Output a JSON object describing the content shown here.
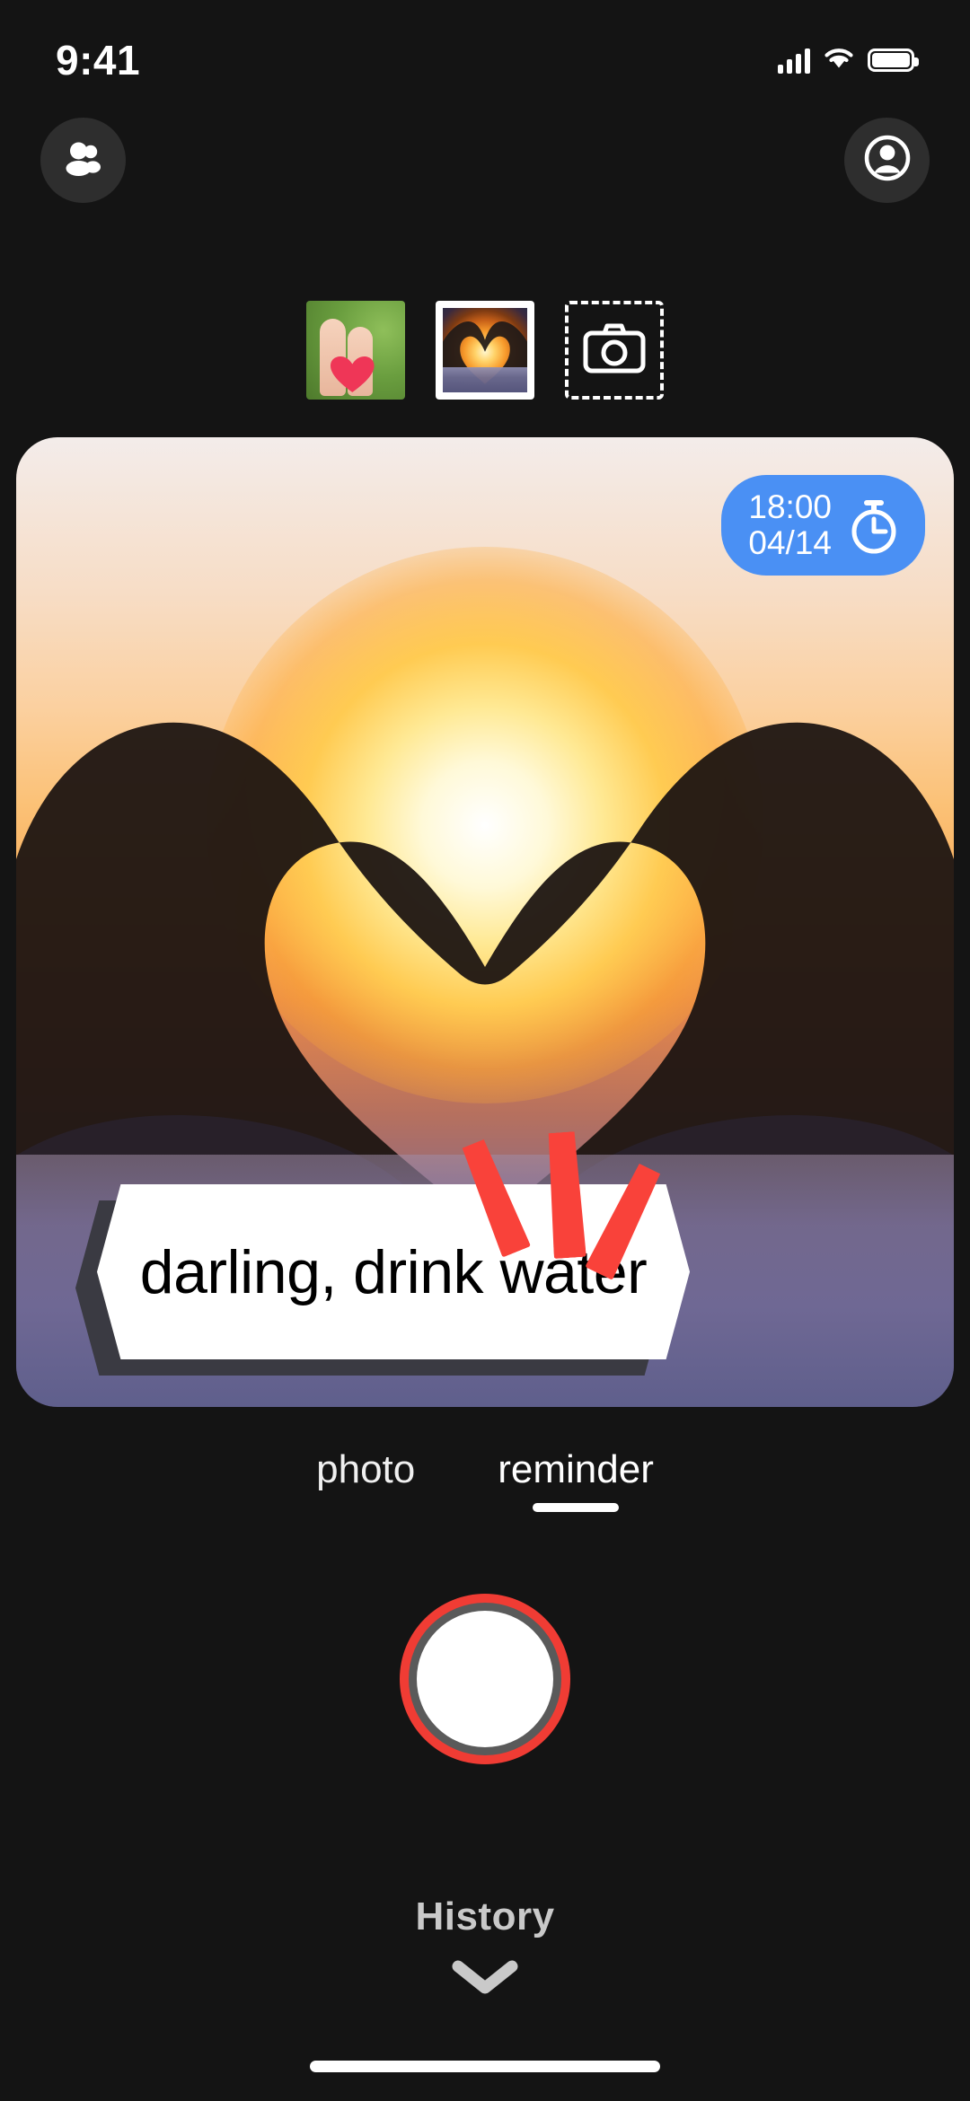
{
  "status_bar": {
    "time": "9:41",
    "signal_icon": "cellular-signal-icon",
    "wifi_icon": "wifi-icon",
    "battery_icon": "battery-full-icon"
  },
  "top_bar": {
    "friends_button": {
      "icon": "people-icon",
      "label": "Friends"
    },
    "account_button": {
      "icon": "account-circle-icon",
      "label": "Account"
    }
  },
  "thumbnail_strip": {
    "items": [
      {
        "name": "thumbnail-fingers-heart",
        "alt": "two fingers holding a red heart",
        "selected": false
      },
      {
        "name": "thumbnail-sunset-hands-heart",
        "alt": "hands forming a heart at sunset",
        "selected": true
      }
    ],
    "camera_button": {
      "icon": "camera-icon",
      "label": "Take photo"
    }
  },
  "photo_card": {
    "alt": "hands forming a heart framing the sun at sunset over the sea",
    "timer_badge": {
      "time": "18:00",
      "date": "04/14",
      "icon": "timer-icon",
      "color": "#4a90f4"
    },
    "banner": {
      "text": "darling, drink water",
      "background": "#ffffff",
      "text_color": "#000000",
      "shadow_color": "#3a3a42",
      "emphasis_icon": "emphasis-strokes-icon",
      "emphasis_color": "#f9423a"
    }
  },
  "tabs": [
    {
      "label": "photo",
      "active": false
    },
    {
      "label": "reminder",
      "active": true
    }
  ],
  "shutter_button": {
    "label": "Capture",
    "ring_color": "#f03c34",
    "mid_ring_color": "#5a5a5a",
    "inner_color": "#ffffff"
  },
  "history": {
    "label": "History",
    "chevron_icon": "chevron-down-icon",
    "color": "#c9c9c9"
  },
  "home_indicator": {
    "name": "home-indicator"
  },
  "theme": {
    "background": "#141414",
    "accent_blue": "#4a90f4",
    "accent_red": "#f03c34"
  }
}
